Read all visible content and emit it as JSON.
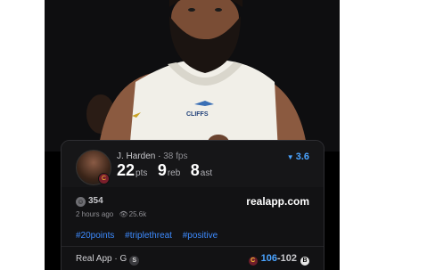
{
  "post": {
    "image_alt": "player photo",
    "jersey": {
      "sponsor": "CLIFFS"
    }
  },
  "card": {
    "player_name": "J. Harden",
    "separator": " · ",
    "fps": "38 fps",
    "rating": "3.6",
    "stats": [
      {
        "value": "22",
        "unit": "pts"
      },
      {
        "value": "9",
        "unit": "reb"
      },
      {
        "value": "8",
        "unit": "ast"
      }
    ],
    "reactions": "354",
    "site": "realapp.com",
    "time_ago": "2 hours ago",
    "views": "25.6k",
    "tags": [
      "#20points",
      "#triplethreat",
      "#positive"
    ],
    "source": "Real App · G",
    "source_badge": "S",
    "score_home": "106",
    "score_sep": "-",
    "score_away": "102"
  },
  "colors": {
    "accent": "#3d8bff",
    "background": "#000000",
    "card": "#121214"
  }
}
